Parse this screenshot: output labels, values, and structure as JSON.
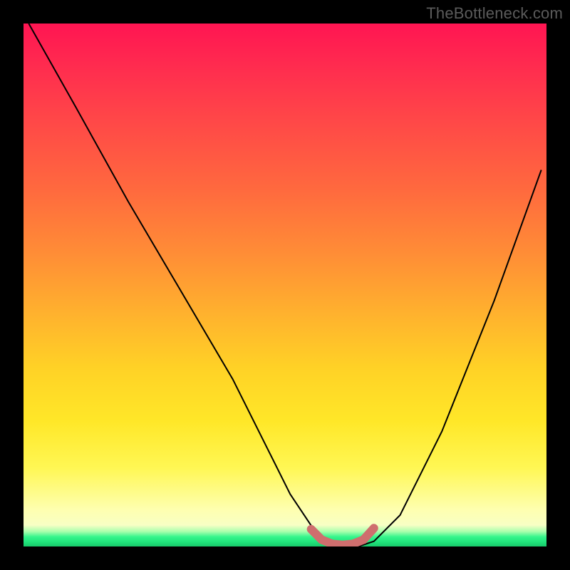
{
  "watermark": {
    "text": "TheBottleneck.com"
  },
  "chart_data": {
    "type": "line",
    "title": "",
    "xlabel": "",
    "ylabel": "",
    "xlim": [
      0,
      100
    ],
    "ylim": [
      0,
      100
    ],
    "grid": false,
    "legend": false,
    "background_gradient": {
      "stops": [
        {
          "pct": 0,
          "color": "#ff1552"
        },
        {
          "pct": 18,
          "color": "#ff4648"
        },
        {
          "pct": 44,
          "color": "#ff8d36"
        },
        {
          "pct": 66,
          "color": "#ffd226"
        },
        {
          "pct": 85,
          "color": "#fff754"
        },
        {
          "pct": 96,
          "color": "#efffe0"
        },
        {
          "pct": 100,
          "color": "#1fe37a"
        }
      ]
    },
    "series": [
      {
        "name": "bottleneck-curve",
        "stroke": "#000000",
        "stroke_width": 2,
        "x": [
          1,
          10,
          20,
          30,
          40,
          47,
          51,
          55,
          58,
          61,
          64,
          67,
          72,
          80,
          90,
          99
        ],
        "y": [
          100,
          84,
          66,
          49,
          32,
          18,
          10,
          4,
          1,
          0,
          0,
          1,
          6,
          22,
          47,
          72
        ]
      },
      {
        "name": "flat-minimum-marker",
        "stroke": "#cf6e6e",
        "stroke_width": 12,
        "stroke_linecap": "round",
        "x": [
          55,
          57,
          59,
          61,
          63,
          65,
          67
        ],
        "y": [
          3.3,
          1.3,
          0.5,
          0.3,
          0.5,
          1.3,
          3.5
        ]
      }
    ],
    "annotations": []
  }
}
